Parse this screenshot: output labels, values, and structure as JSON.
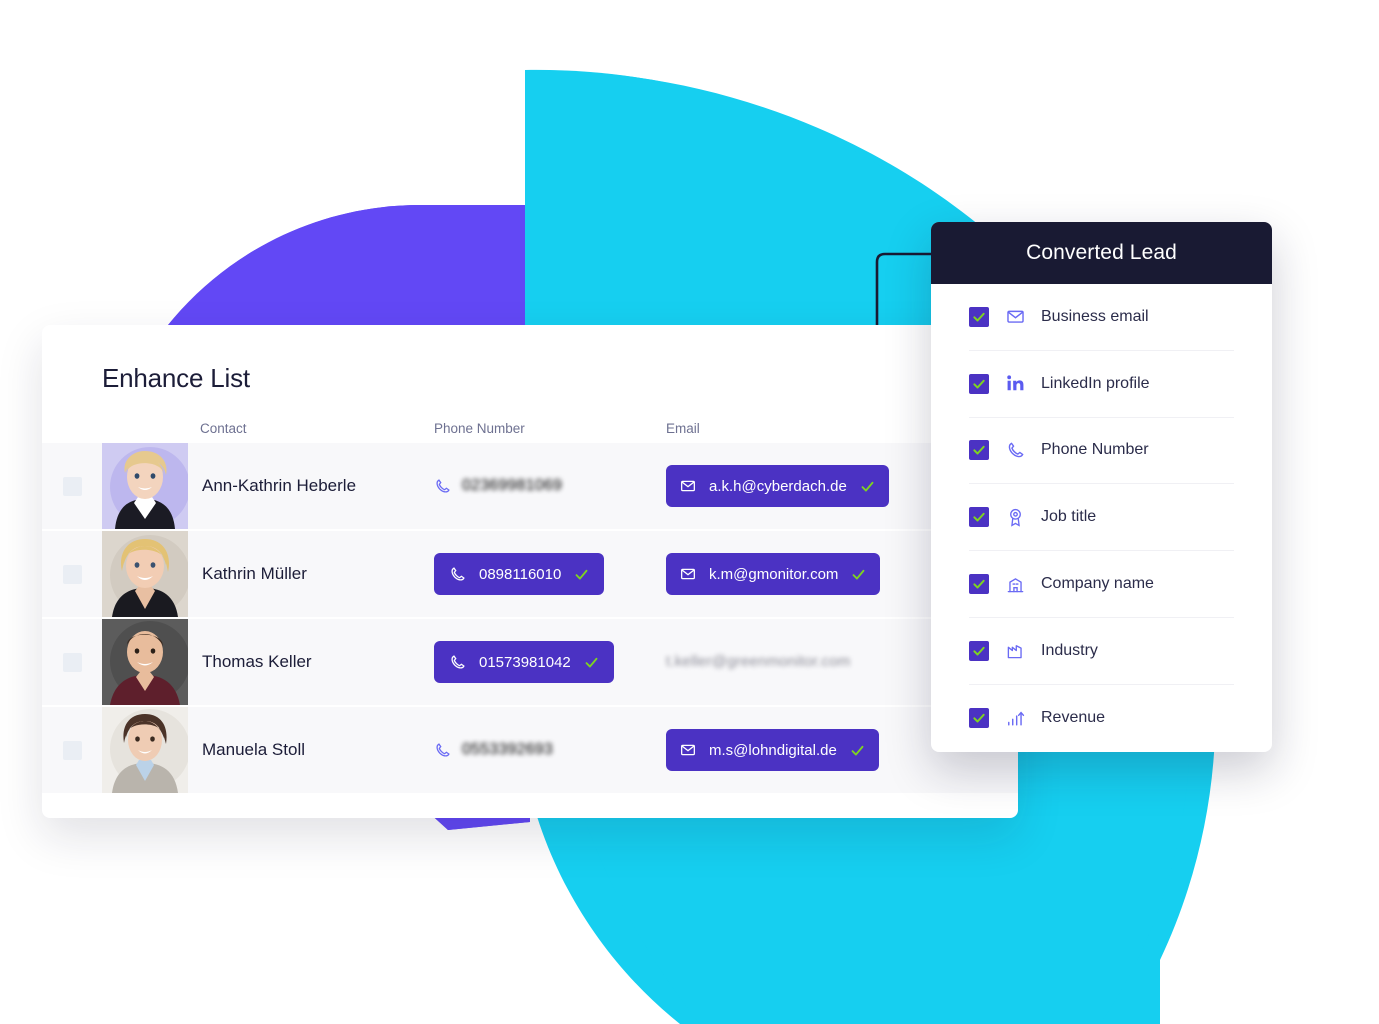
{
  "palette": {
    "cyan": "#16CFF0",
    "purple_wedge": "#6248F5",
    "pill_purple": "#4B32C3",
    "check_green": "#7ED321",
    "panel_header_dark": "#191A33",
    "row_bg": "#F8F8FA",
    "text_dark": "#1C1D38",
    "text_muted": "#6E7191",
    "icon_indigo": "#6A6AF4",
    "checkbox_empty": "#EAEEF4"
  },
  "card": {
    "title": "Enhance List",
    "columns": [
      {
        "key": "contact",
        "label": "Contact"
      },
      {
        "key": "phone",
        "label": "Phone Number"
      },
      {
        "key": "email",
        "label": "Email"
      }
    ],
    "rows": [
      {
        "checkbox_checked": false,
        "name": "Ann-Kathrin Heberle",
        "avatar_bg": "#CFCBF2",
        "avatar_hair": "#E6C98E",
        "avatar_skin": "#F3D4BE",
        "avatar_cloth": "#1B1B24",
        "phone": "02369981069",
        "phone_verified": false,
        "email": "a.k.h@cyberdach.de",
        "email_verified": true
      },
      {
        "checkbox_checked": false,
        "name": "Kathrin Müller",
        "avatar_bg": "#DCD6CD",
        "avatar_hair": "#E3C274",
        "avatar_skin": "#F2CDB4",
        "avatar_cloth": "#1A1A20",
        "phone": "0898116010",
        "phone_verified": true,
        "email": "k.m@gmonitor.com",
        "email_verified": true
      },
      {
        "checkbox_checked": false,
        "name": "Thomas Keller",
        "avatar_bg": "#5C5C5C",
        "avatar_hair": "#3B2A20",
        "avatar_skin": "#E8BC9C",
        "avatar_cloth": "#5E1F2C",
        "phone": "01573981042",
        "phone_verified": true,
        "email": "t.keller@greenmonitor.com",
        "email_verified": false
      },
      {
        "checkbox_checked": false,
        "name": "Manuela Stoll",
        "avatar_bg": "#F0EEEA",
        "avatar_hair": "#4B3328",
        "avatar_skin": "#EFCCB4",
        "avatar_cloth": "#B9B4AC",
        "phone": "0553392693",
        "phone_verified": false,
        "email": "m.s@lohndigital.de",
        "email_verified": true
      }
    ]
  },
  "panel": {
    "title": "Converted Lead",
    "items": [
      {
        "label": "Business email",
        "icon": "envelope-icon",
        "checked": true
      },
      {
        "label": "LinkedIn profile",
        "icon": "linkedin-icon",
        "checked": true
      },
      {
        "label": "Phone Number",
        "icon": "phone-icon",
        "checked": true
      },
      {
        "label": "Job title",
        "icon": "badge-icon",
        "checked": true
      },
      {
        "label": "Company name",
        "icon": "building-icon",
        "checked": true
      },
      {
        "label": "Industry",
        "icon": "factory-icon",
        "checked": true
      },
      {
        "label": "Revenue",
        "icon": "bar-chart-up-icon",
        "checked": true
      }
    ]
  },
  "connector": {
    "node_icon": "data-node-icon"
  }
}
